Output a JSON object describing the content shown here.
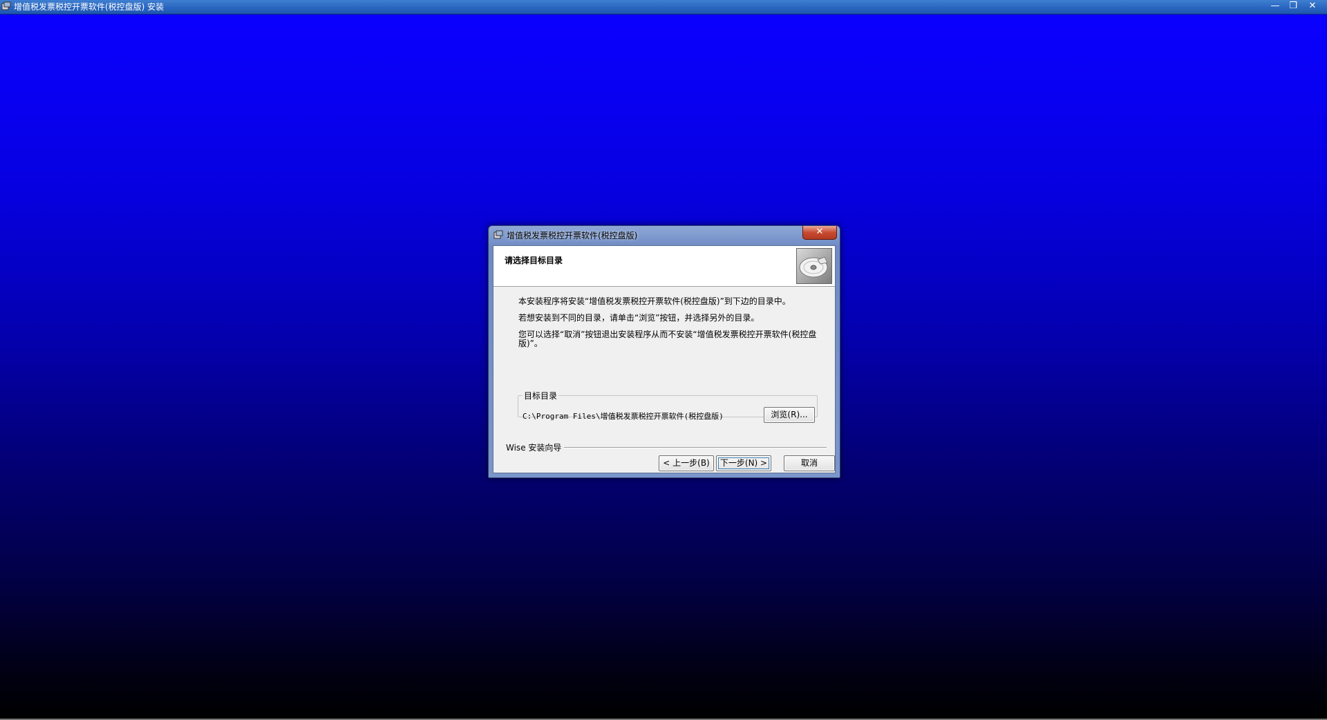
{
  "app": {
    "title": "增值税发票税控开票软件(税控盘版) 安装",
    "min_glyph": "—",
    "max_glyph": "❐",
    "close_glyph": "✕"
  },
  "dialog": {
    "title": "增值税发票税控开票软件(税控盘版)",
    "close_glyph": "✕",
    "header_title": "请选择目标目录",
    "header_icon": "cd-disc-icon",
    "line1": "本安装程序将安装“增值税发票税控开票软件(税控盘版)”到下边的目录中。",
    "line2": "若想安装到不同的目录，请单击“浏览”按钮，并选择另外的目录。",
    "line3": "您可以选择“取消”按钮退出安装程序从而不安装“增值税发票税控开票软件(税控盘版)”。",
    "destination": {
      "label": "目标目录",
      "path": "C:\\Program Files\\增值税发票税控开票软件(税控盘版)",
      "browse_label": "浏览(R)..."
    },
    "wise_label": "Wise 安装向导",
    "buttons": {
      "back": "< 上一步(B)",
      "next": "下一步(N) >",
      "cancel": "取消"
    }
  }
}
